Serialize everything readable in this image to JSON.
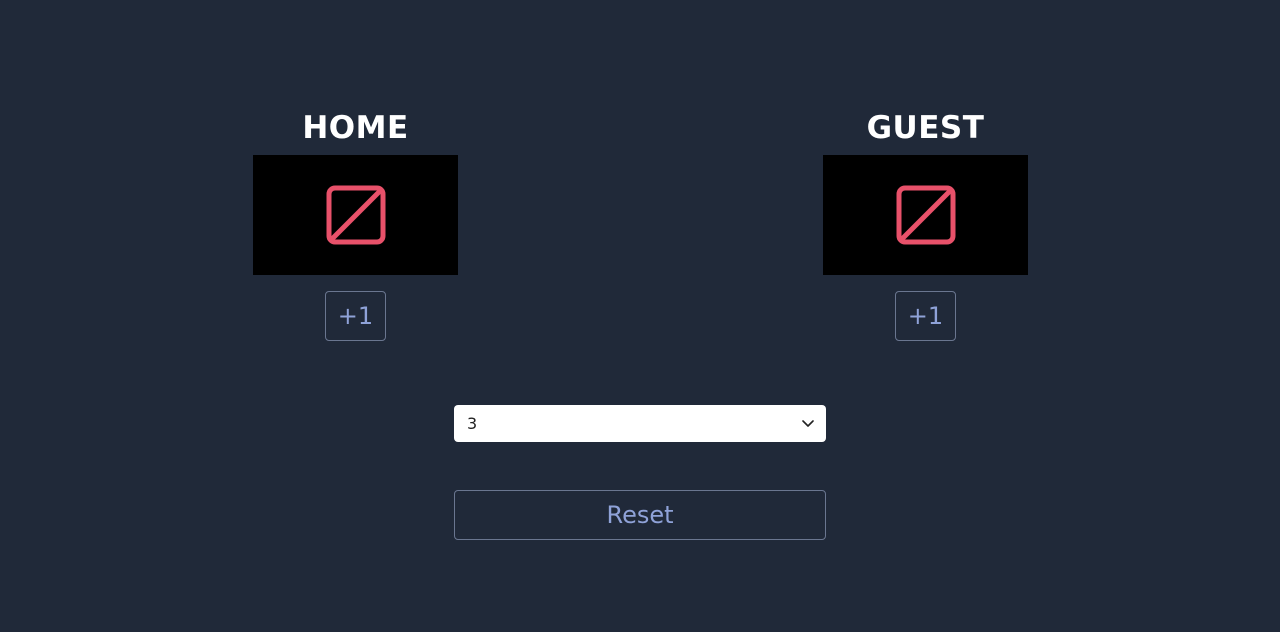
{
  "teams": {
    "home": {
      "name": "HOME",
      "score_icon": "broken-image-icon",
      "increment_label": "+1"
    },
    "guest": {
      "name": "GUEST",
      "score_icon": "broken-image-icon",
      "increment_label": "+1"
    }
  },
  "period_select": {
    "selected_value": "3",
    "icon": "chevron-down-icon"
  },
  "reset": {
    "label": "Reset"
  },
  "colors": {
    "background": "#202939",
    "score_box": "#000000",
    "icon_red": "#e8516a",
    "button_text": "#8fa2d8",
    "button_border": "#6a7690"
  }
}
